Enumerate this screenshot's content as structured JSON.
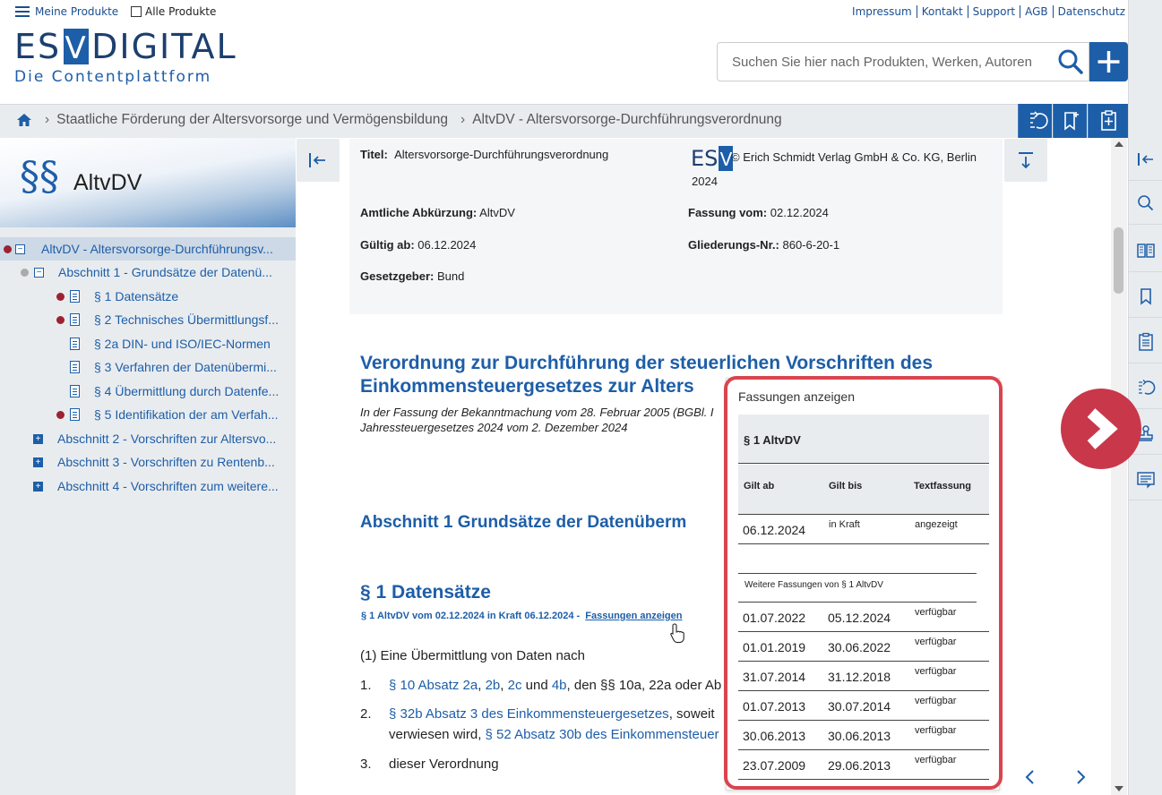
{
  "topbar": {
    "my_products": "Meine Produkte",
    "all_products": "Alle Produkte",
    "links": [
      "Impressum",
      "Kontakt",
      "Support",
      "AGB",
      "Datenschutz"
    ]
  },
  "logo": {
    "left": "ES",
    "v": "V",
    "right": "DIGITAL",
    "tagline": "Die Contentplattform"
  },
  "search": {
    "placeholder": "Suchen Sie hier nach Produkten, Werken, Autoren"
  },
  "breadcrumb": {
    "items": [
      "Staatliche Förderung der Altersvorsorge und Vermögensbildung",
      "AltvDV - Altersvorsorge-Durchführungsverordnung"
    ]
  },
  "sidebar": {
    "symbol": "§§",
    "title": "AltvDV",
    "tree": [
      {
        "label": "AltvDV - Altersvorsorge-Durchführungsv...",
        "dot": "red",
        "toggle": "−"
      },
      {
        "label": "Abschnitt 1 - Grundsätze der Datenü...",
        "dot": "grey",
        "toggle": "−"
      },
      {
        "label": "§ 1 Datensätze",
        "dot": "red"
      },
      {
        "label": "§ 2 Technisches Übermittlungsf...",
        "dot": "red"
      },
      {
        "label": "§ 2a DIN- und ISO/IEC-Normen",
        "dot": ""
      },
      {
        "label": "§ 3 Verfahren der Datenübermi...",
        "dot": ""
      },
      {
        "label": "§ 4 Übermittlung durch Datenfe...",
        "dot": ""
      },
      {
        "label": "§ 5 Identifikation der am Verfah...",
        "dot": "red"
      },
      {
        "label": "Abschnitt 2 - Vorschriften zur Altersvo...",
        "toggle": "+"
      },
      {
        "label": "Abschnitt 3 - Vorschriften zu Rentenb...",
        "toggle": "+"
      },
      {
        "label": "Abschnitt 4 - Vorschriften zum weitere...",
        "toggle": "+"
      }
    ]
  },
  "meta": {
    "titel_label": "Titel:",
    "titel": "Altersvorsorge-Durchführungsverordnung",
    "publisher_logo": "ESV",
    "copyright": "© Erich Schmidt Verlag GmbH & Co. KG, Berlin",
    "year": "2024",
    "abk_label": "Amtliche Abkürzung:",
    "abk": "AltvDV",
    "fassung_label": "Fassung vom:",
    "fassung": "02.12.2024",
    "gueltig_label": "Gültig ab:",
    "gueltig": "06.12.2024",
    "gliederung_label": "Gliederungs-Nr.:",
    "gliederung": "860-6-20-1",
    "gesetzgeber_label": "Gesetzgeber:",
    "gesetzgeber": "Bund"
  },
  "document": {
    "title_line1": "Verordnung zur Durchführung der steuerlichen Vorschriften des",
    "title_line2": "Einkommensteuergesetzes zur Alters",
    "subtitle_line1": "In der Fassung der Bekanntmachung vom 28. Februar 2005 (BGBl. I",
    "subtitle_line2": "Jahressteuergesetzes 2024 vom 2. Dezember 2024",
    "abschnitt": "Abschnitt 1  Grundsätze der Datenüberm",
    "para_title": "§ 1  Datensätze",
    "para_meta": "§ 1 AltvDV vom 02.12.2024 in Kraft 06.12.2024 -",
    "para_meta_link": "Fassungen anzeigen",
    "intro": "(1)  Eine Übermittlung von Daten nach",
    "items": [
      {
        "num": "1.",
        "link1": "§ 10 Absatz 2a",
        "c1": ", ",
        "link2": "2b",
        "c2": ", ",
        "link3": "2c",
        "c3": " und ",
        "link4": "4b",
        "rest": ", den §§ 10a, 22a oder Ab"
      },
      {
        "num": "2.",
        "link1": "§ 32b Absatz 3 des Einkommensteuergesetzes",
        "rest": ", soweit",
        "line2_pre": "verwiesen wird, ",
        "line2_link": "§ 52 Absatz 30b des Einkommensteuer"
      },
      {
        "num": "3.",
        "text": "dieser Verordnung"
      }
    ]
  },
  "popup": {
    "title": "Fassungen anzeigen",
    "header": "§ 1 AltvDV",
    "columns": [
      "Gilt ab",
      "Gilt bis",
      "Textfassung"
    ],
    "current": {
      "from": "06.12.2024",
      "to": "in Kraft",
      "status": "angezeigt"
    },
    "weitere": "Weitere Fassungen von § 1 AltvDV",
    "rows": [
      {
        "from": "01.07.2022",
        "to": "05.12.2024",
        "status": "verfügbar"
      },
      {
        "from": "01.01.2019",
        "to": "30.06.2022",
        "status": "verfügbar"
      },
      {
        "from": "31.07.2014",
        "to": "31.12.2018",
        "status": "verfügbar"
      },
      {
        "from": "01.07.2013",
        "to": "30.07.2014",
        "status": "verfügbar"
      },
      {
        "from": "30.06.2013",
        "to": "30.06.2013",
        "status": "verfügbar"
      },
      {
        "from": "23.07.2009",
        "to": "29.06.2013",
        "status": "verfügbar"
      }
    ]
  },
  "colors": {
    "brand": "#1d5ea8",
    "dark": "#1c3f6e",
    "highlight": "#d9444f",
    "arrow": "#c8384a"
  },
  "icons": {
    "right_toolbar": [
      "collapse-right-icon",
      "search-icon",
      "book-icon",
      "bookmark-icon",
      "clipboard-icon",
      "history-icon",
      "stamp-icon",
      "notes-icon"
    ]
  }
}
